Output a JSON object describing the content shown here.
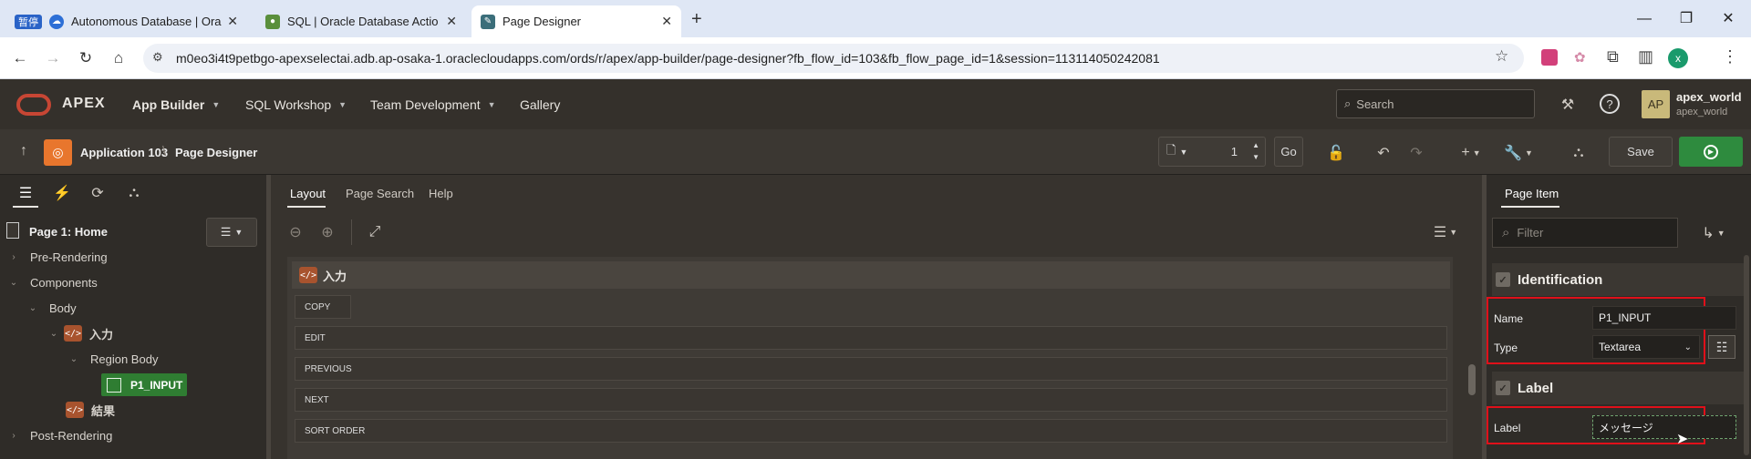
{
  "browser": {
    "tabs": [
      {
        "label": "Autonomous Database | Ora",
        "badge": "暂停"
      },
      {
        "label": "SQL | Oracle Database Actio"
      },
      {
        "label": "Page Designer"
      }
    ],
    "url": "m0eo3i4t9petbgo-apexselectai.adb.ap-osaka-1.oraclecloudapps.com/ords/r/apex/app-builder/page-designer?fb_flow_id=103&fb_flow_page_id=1&session=113114050242081",
    "profile_initial": "x"
  },
  "apex": {
    "logo_text": "APEX",
    "menus": [
      "App Builder",
      "SQL Workshop",
      "Team Development",
      "Gallery"
    ],
    "search_placeholder": "Search",
    "user": {
      "initials": "AP",
      "name": "apex_world",
      "workspace": "apex_world"
    }
  },
  "toolbar": {
    "app_label": "Application 103",
    "page_designer_label": "Page Designer",
    "page_number": "1",
    "go_label": "Go",
    "save_label": "Save"
  },
  "left": {
    "page_title": "Page 1: Home",
    "tree": {
      "pre_rendering": "Pre-Rendering",
      "components": "Components",
      "body": "Body",
      "region_input": "入力",
      "region_body": "Region Body",
      "item": "P1_INPUT",
      "region_result": "結果",
      "post_rendering": "Post-Rendering"
    }
  },
  "center": {
    "tabs": [
      "Layout",
      "Page Search",
      "Help"
    ],
    "region_title": "入力",
    "buttons": [
      "COPY",
      "EDIT",
      "PREVIOUS",
      "NEXT",
      "SORT ORDER"
    ]
  },
  "right": {
    "tab": "Page Item",
    "filter_placeholder": "Filter",
    "identification": {
      "title": "Identification",
      "name_label": "Name",
      "name_value": "P1_INPUT",
      "type_label": "Type",
      "type_value": "Textarea"
    },
    "label_section": {
      "title": "Label",
      "label_label": "Label",
      "label_value": "メッセージ"
    }
  },
  "colors": {
    "accent_green": "#2f7d32",
    "save_green": "#2e8b3e",
    "highlight": "#e0101a",
    "app_icon": "#e8762d"
  }
}
